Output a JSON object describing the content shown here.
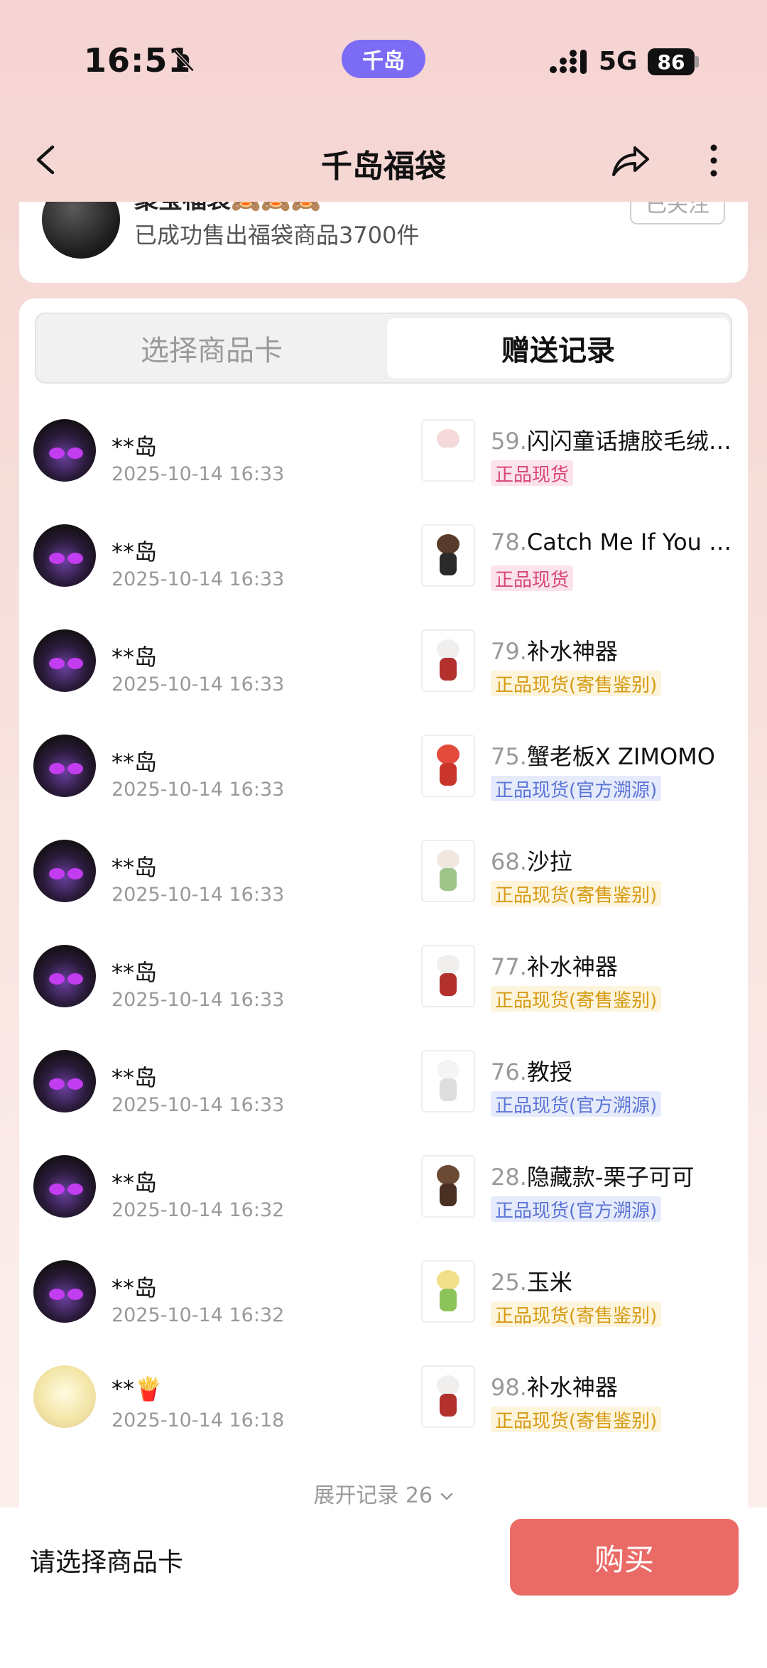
{
  "status_bar": {
    "time": "16:51",
    "island_label": "千岛",
    "network": "5G",
    "battery": "86"
  },
  "nav": {
    "title": "千岛福袋"
  },
  "shop": {
    "name": "聚宝福袋🙈🙈🙈",
    "sold_text": "已成功售出福袋商品3700件",
    "follow_label": "已关注"
  },
  "tabs": {
    "left": "选择商品卡",
    "right": "赠送记录"
  },
  "records": [
    {
      "user": "**岛",
      "time": "2025-10-14 16:33",
      "index": "59.",
      "product": "闪闪童话搪胶毛绒…",
      "badge": "正品现货",
      "badge_style": "pink"
    },
    {
      "user": "**岛",
      "time": "2025-10-14 16:33",
      "index": "78.",
      "product": "Catch Me If You …",
      "badge": "正品现货",
      "badge_style": "pink"
    },
    {
      "user": "**岛",
      "time": "2025-10-14 16:33",
      "index": "79.",
      "product": "补水神器",
      "badge": "正品现货(寄售鉴别)",
      "badge_style": "yellow"
    },
    {
      "user": "**岛",
      "time": "2025-10-14 16:33",
      "index": "75.",
      "product": "蟹老板X ZIMOMO",
      "badge": "正品现货(官方溯源)",
      "badge_style": "blue"
    },
    {
      "user": "**岛",
      "time": "2025-10-14 16:33",
      "index": "68.",
      "product": "沙拉",
      "badge": "正品现货(寄售鉴别)",
      "badge_style": "yellow"
    },
    {
      "user": "**岛",
      "time": "2025-10-14 16:33",
      "index": "77.",
      "product": "补水神器",
      "badge": "正品现货(寄售鉴别)",
      "badge_style": "yellow"
    },
    {
      "user": "**岛",
      "time": "2025-10-14 16:33",
      "index": "76.",
      "product": "教授",
      "badge": "正品现货(官方溯源)",
      "badge_style": "blue"
    },
    {
      "user": "**岛",
      "time": "2025-10-14 16:32",
      "index": "28.",
      "product": "隐藏款-栗子可可",
      "badge": "正品现货(官方溯源)",
      "badge_style": "blue"
    },
    {
      "user": "**岛",
      "time": "2025-10-14 16:32",
      "index": "25.",
      "product": "玉米",
      "badge": "正品现货(寄售鉴别)",
      "badge_style": "yellow"
    },
    {
      "user": "**🍟",
      "time": "2025-10-14 16:18",
      "index": "98.",
      "product": "补水神器",
      "badge": "正品现货(寄售鉴别)",
      "badge_style": "yellow"
    }
  ],
  "expand_label": "展开记录 26",
  "bottom": {
    "label": "请选择商品卡",
    "buy_label": "购买"
  },
  "colors": {
    "badge_pink_bg": "#fbe3ec",
    "badge_pink_fg": "#d9457a",
    "badge_yellow_bg": "#fdf4dc",
    "badge_yellow_fg": "#d69a12",
    "badge_blue_bg": "#e6ebfb",
    "badge_blue_fg": "#5b74d6",
    "buy_button": "#ea6b66"
  }
}
